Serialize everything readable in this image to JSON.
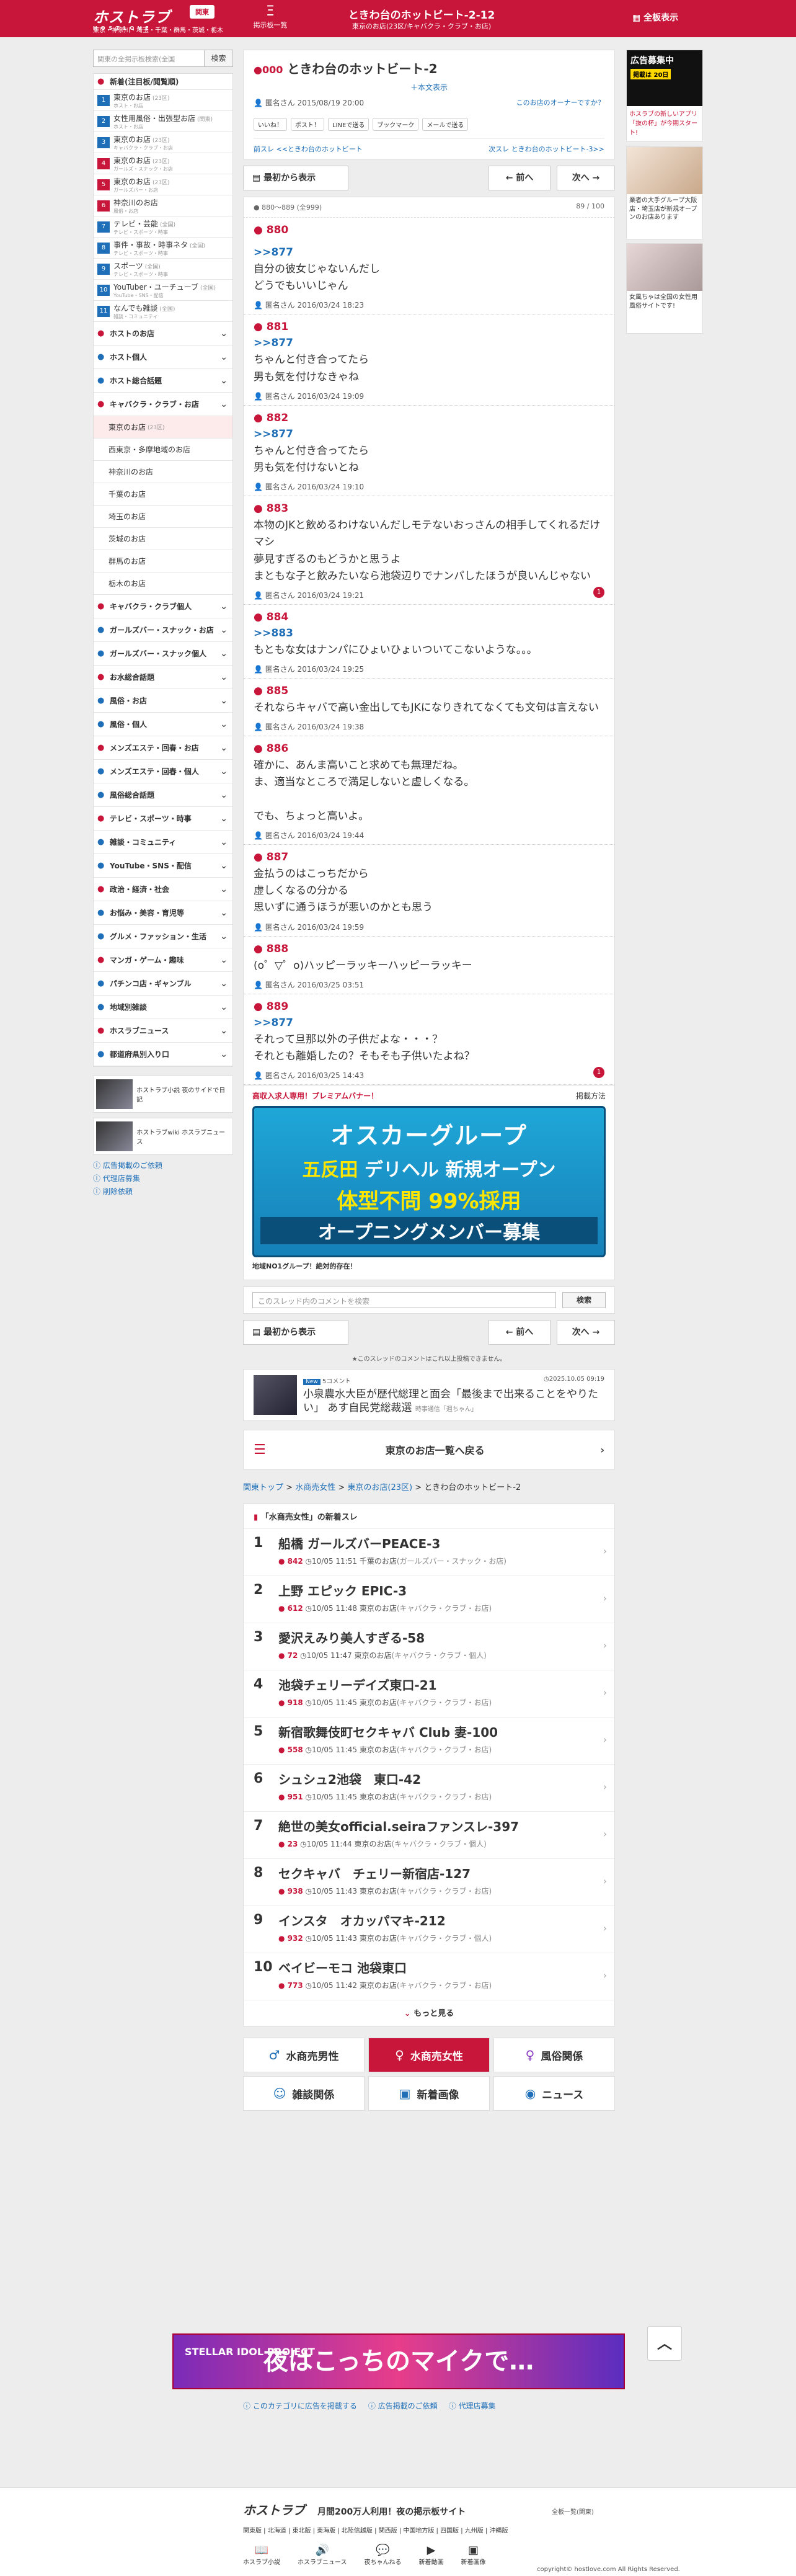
{
  "header": {
    "logo": "ホストラブ",
    "logo_sub": "HOSTLOVE",
    "area_button": "関東",
    "areas": "東京・神奈川・埼玉・千葉・群馬・茨城・栃木",
    "board_list": "Ξ",
    "board_list_label": "掲示板一覧",
    "title": "ときわ台のホットビート-2-12",
    "subtitle": "東京のお店(23区/キャバクラ・クラブ・お店)",
    "full_view": "全板表示"
  },
  "sidebar": {
    "search_placeholder": "関東の全掲示板検索(全国",
    "search_button": "検索",
    "items": [
      {
        "label": "新着(注目板/閲覧順)",
        "icon": "●"
      },
      {
        "num": "1",
        "label": "東京のお店",
        "cnt": "(23区)",
        "small": "ホスト・お店"
      },
      {
        "num": "2",
        "label": "女性用風俗・出張型お店",
        "cnt": "(関東)",
        "small": "ホスト・お店"
      },
      {
        "num": "3",
        "label": "東京のお店",
        "cnt": "(23区)",
        "small": "キャバクラ・クラブ・お店"
      },
      {
        "num": "4",
        "label": "東京のお店",
        "cnt": "(23区)",
        "small": "ガールズ・スナック・お店"
      },
      {
        "num": "5",
        "label": "東京のお店",
        "cnt": "(23区)",
        "small": "ガールズバー・お店"
      },
      {
        "num": "6",
        "label": "神奈川のお店",
        "cnt": "",
        "small": "風俗・お店"
      },
      {
        "num": "7",
        "label": "テレビ・芸能",
        "cnt": "(全国)",
        "small": "テレビ・スポーツ・時事"
      },
      {
        "num": "8",
        "label": "事件・事故・時事ネタ",
        "cnt": "(全国)",
        "small": "テレビ・スポーツ・時事"
      },
      {
        "num": "9",
        "label": "スポーツ",
        "cnt": "(全国)",
        "small": "テレビ・スポーツ・時事"
      },
      {
        "num": "10",
        "label": "YouTuber・ユーチューブ",
        "cnt": "(全国)",
        "small": "YouTube・SNS・配信"
      },
      {
        "num": "11",
        "label": "なんでも雑談",
        "cnt": "(全国)",
        "small": "雑談・コミュニティ"
      }
    ],
    "categories": [
      {
        "label": "ホストのお店"
      },
      {
        "label": "ホスト個人"
      },
      {
        "label": "ホスト総合話題"
      },
      {
        "label": "キャバクラ・クラブ・お店"
      }
    ],
    "subareas": [
      {
        "label": "東京のお店",
        "cnt": "(23区)"
      },
      {
        "label": "西東京・多摩地域のお店",
        "cnt": ""
      },
      {
        "label": "神奈川のお店",
        "cnt": ""
      },
      {
        "label": "千葉のお店",
        "cnt": ""
      },
      {
        "label": "埼玉のお店",
        "cnt": ""
      },
      {
        "label": "茨城のお店",
        "cnt": ""
      },
      {
        "label": "群馬のお店",
        "cnt": ""
      },
      {
        "label": "栃木のお店",
        "cnt": ""
      }
    ],
    "categories2": [
      {
        "label": "キャバクラ・クラブ個人"
      },
      {
        "label": "ガールズバー・スナック・お店"
      },
      {
        "label": "ガールズバー・スナック個人"
      },
      {
        "label": "お水総合話題"
      },
      {
        "label": "風俗・お店"
      },
      {
        "label": "風俗・個人"
      },
      {
        "label": "メンズエステ・回春・お店"
      },
      {
        "label": "メンズエステ・回春・個人"
      },
      {
        "label": "風俗総合話題"
      },
      {
        "label": "テレビ・スポーツ・時事"
      },
      {
        "label": "雑談・コミュニティ"
      },
      {
        "label": "YouTube・SNS・配信"
      },
      {
        "label": "政治・経済・社会"
      },
      {
        "label": "お悩み・美容・育児等"
      },
      {
        "label": "グルメ・ファッション・生活"
      },
      {
        "label": "マンガ・ゲーム・趣味"
      },
      {
        "label": "パチンコ店・ギャンブル"
      },
      {
        "label": "地域別雑談"
      },
      {
        "label": "ホスラブニュース"
      },
      {
        "label": "都道府県別入り口"
      }
    ],
    "banners": [
      {
        "text": "ホストラブ小説 夜のサイドで日記"
      },
      {
        "text": "ホストラブwiki ホスラブニュース"
      }
    ],
    "links": [
      "広告掲載のご依頼",
      "代理店募集",
      "削除依頼"
    ]
  },
  "right_ads": {
    "a1_title": "広告募集中",
    "a1_sub": "掲載は 20日",
    "a1_text": "ホスラブの新しいアプリ「抜の杯」が今期スタート!",
    "a2_text": "業者の大手グループ大阪店・埼玉店が新規オープンのお店あります",
    "a3_text": "女風ちゃは全国の女性用風俗サイトです!"
  },
  "thread": {
    "number": "000",
    "title": "ときわ台のホットビート-2",
    "jump": "＋本文表示",
    "author": "匿名さん 2015/08/19 20:00",
    "owner_link": "このお店のオーナーですか？",
    "share": [
      "いいね！",
      "ポスト！",
      "LINEで送る",
      "ブックマーク",
      "メールで送る"
    ],
    "prev": "前スレ <<ときわ台のホットビート",
    "next": "次スレ ときわ台のホットビート-3>>"
  },
  "nav": {
    "first": "最初から表示",
    "prev": "前へ",
    "next": "次へ",
    "range": "880〜889 (全999)",
    "page": "89 / 100"
  },
  "posts": [
    {
      "no": "880",
      "anchor": "",
      "body": "",
      "by": ""
    },
    {
      "no": "",
      "anchor": ">>877",
      "body": "自分の彼女じゃないんだし\nどうでもいいじゃん",
      "by": "匿名さん 2016/03/24 18:23"
    },
    {
      "no": "881",
      "anchor": ">>877",
      "body": "ちゃんと付き合ってたら\n男も気を付けなきゃね",
      "by": "匿名さん 2016/03/24 19:09"
    },
    {
      "no": "882",
      "anchor": ">>877",
      "body": "ちゃんと付き合ってたら\n男も気を付けないとね",
      "by": "匿名さん 2016/03/24 19:10"
    },
    {
      "no": "883",
      "anchor": "",
      "body": "本物のJKと飲めるわけないんだしモテないおっさんの相手してくれるだけマシ\n夢見すぎるのもどうかと思うよ\nまともな子と飲みたいなら池袋辺りでナンパしたほうが良いんじゃない",
      "by": "匿名さん 2016/03/24 19:21",
      "badge": "1"
    },
    {
      "no": "884",
      "anchor": ">>883",
      "body": "もともな女はナンパにひょいひょいついてこないような。。。",
      "by": "匿名さん 2016/03/24 19:25"
    },
    {
      "no": "885",
      "anchor": "",
      "body": "それならキャバで高い金出してもJKになりきれてなくても文句は言えない",
      "by": "匿名さん 2016/03/24 19:38"
    },
    {
      "no": "886",
      "anchor": "",
      "body": "確かに、あんま高いこと求めても無理だね。\nま、適当なところで満足しないと虚しくなる。\n\nでも、ちょっと高いよ。",
      "by": "匿名さん 2016/03/24 19:44"
    },
    {
      "no": "887",
      "anchor": "",
      "body": "金払うのはこっちだから\n虚しくなるの分かる\n思いずに通うほうが悪いのかとも思う",
      "by": "匿名さん 2016/03/24 19:59"
    },
    {
      "no": "888",
      "anchor": "",
      "body": "(o゜▽゜o)ハッピーラッキーハッピーラッキー",
      "by": "匿名さん 2016/03/25 03:51"
    },
    {
      "no": "889",
      "anchor": ">>877",
      "body": "それって旦那以外の子供だよな・・・？\nそれとも離婚したの？そもそも子供いたよね？",
      "by": "匿名さん 2016/03/25 14:43",
      "badge": "1"
    }
  ],
  "premium": {
    "label": "高収入求人専用！プレミアムバナー！",
    "apply": "掲載方法",
    "b1": "オスカーグループ",
    "b2a": "五反田",
    "b2b": "デリヘル 新規オープン",
    "b3": "体型不問 99%採用",
    "b4": "オープニングメンバー募集",
    "caption": "地域NO1グループ！絶対的存在！"
  },
  "comment_search": {
    "placeholder": "このスレッド内のコメントを検索",
    "button": "検索"
  },
  "end_note": "★このスレッドのコメントはこれ以上投稿できません。",
  "news": {
    "badge": "New",
    "comments": "5コメント",
    "date": "2025.10.05 09:19",
    "headline": "小泉農水大臣が歴代総理と面会「最後まで出来ることをやりたい」 あす自民党総裁選",
    "source": "時事通信「週ちゃん」"
  },
  "back_button": "東京のお店一覧へ戻る",
  "breadcrumb": {
    "items": [
      "関東トップ",
      "水商売女性",
      "東京のお店(23区)"
    ],
    "current": "ときわ台のホットビート-2"
  },
  "new_threads": {
    "title": "「水商売女性」の新着スレ",
    "items": [
      {
        "rank": "1",
        "title": "船橋 ガールズバーPEACE-3",
        "count": "842",
        "time": "10/05 11:51",
        "board": "千葉のお店",
        "cat": "(ガールズバー・スナック・お店)"
      },
      {
        "rank": "2",
        "title": "上野 エピック EPIC-3",
        "count": "612",
        "time": "10/05 11:48",
        "board": "東京のお店",
        "cat": "(キャバクラ・クラブ・お店)"
      },
      {
        "rank": "3",
        "title": "愛沢えみり美人すぎる-58",
        "count": "72",
        "time": "10/05 11:47",
        "board": "東京のお店",
        "cat": "(キャバクラ・クラブ・個人)"
      },
      {
        "rank": "4",
        "title": "池袋チェリーデイズ東口-21",
        "count": "918",
        "time": "10/05 11:45",
        "board": "東京のお店",
        "cat": "(キャバクラ・クラブ・お店)"
      },
      {
        "rank": "5",
        "title": "新宿歌舞伎町セクキャバ Club 妻-100",
        "count": "558",
        "time": "10/05 11:45",
        "board": "東京のお店",
        "cat": "(キャバクラ・クラブ・お店)"
      },
      {
        "rank": "6",
        "title": "シュシュ2池袋　東口-42",
        "count": "951",
        "time": "10/05 11:45",
        "board": "東京のお店",
        "cat": "(キャバクラ・クラブ・お店)"
      },
      {
        "rank": "7",
        "title": "絶世の美女official.seiraファンスレ-397",
        "count": "23",
        "time": "10/05 11:44",
        "board": "東京のお店",
        "cat": "(キャバクラ・クラブ・個人)"
      },
      {
        "rank": "8",
        "title": "セクキャバ　チェリー新宿店-127",
        "count": "938",
        "time": "10/05 11:43",
        "board": "東京のお店",
        "cat": "(キャバクラ・クラブ・お店)"
      },
      {
        "rank": "9",
        "title": "インスタ　オカッパマキ-212",
        "count": "932",
        "time": "10/05 11:43",
        "board": "東京のお店",
        "cat": "(キャバクラ・クラブ・個人)"
      },
      {
        "rank": "10",
        "title": "ベイビーモコ 池袋東口",
        "count": "773",
        "time": "10/05 11:42",
        "board": "東京のお店",
        "cat": "(キャバクラ・クラブ・お店)"
      }
    ],
    "more": "もっと見る"
  },
  "cats": [
    {
      "label": "水商売男性",
      "icon": "♂"
    },
    {
      "label": "水商売女性",
      "icon": "♀"
    },
    {
      "label": "風俗関係",
      "icon": "♀"
    },
    {
      "label": "雑談関係",
      "icon": "☺"
    },
    {
      "label": "新着画像",
      "icon": "▣"
    },
    {
      "label": "ニュース",
      "icon": "◉"
    }
  ],
  "ad_banner": {
    "left": "STELLAR IDOL PROJECT",
    "main": "夜はこっちのマイクで…"
  },
  "bottom_links": [
    "このカテゴリに広告を掲載する",
    "広告掲載のご依頼",
    "代理店募集"
  ],
  "footer": {
    "logo": "ホストラブ",
    "slogan": "月間200万人利用！夜の掲示板サイト",
    "all": "全板一覧(関東)",
    "areas": "関東版 | 北海道 | 東北版 | 東海版 | 北陸信越版 | 関西版 | 中国地方版 | 四国版 | 九州版 | 沖縄版",
    "icons": [
      "ホスラブ小説",
      "ホスラブニュース",
      "夜ちゃんねる",
      "新着動画",
      "新着画像"
    ],
    "copy": "copyright© hostlove.com All Rights Reserved."
  }
}
